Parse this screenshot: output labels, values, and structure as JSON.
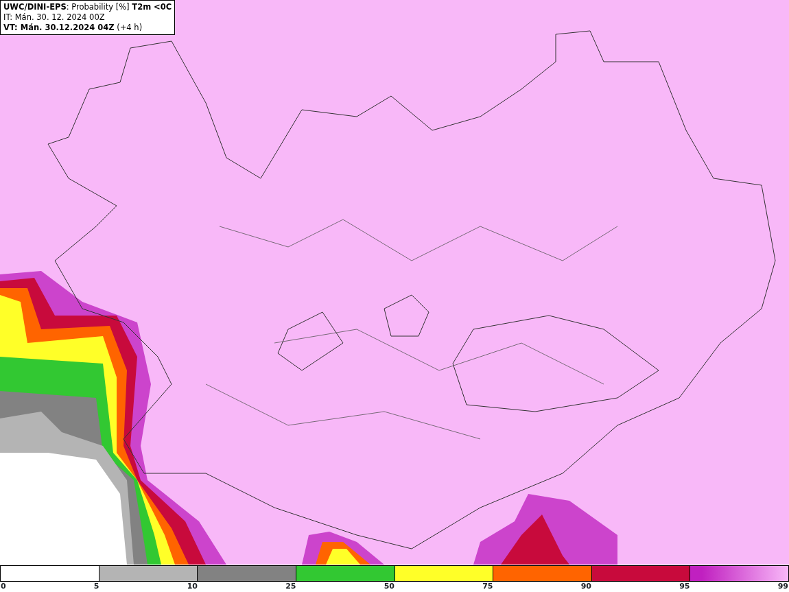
{
  "header": {
    "line_1": "**UWC/DINI-EPS**: Probability [%] **T2m <0C**",
    "line_2": "IT: Mán. 30. 12. 2024 00Z",
    "line_3": "**VT: Mán. 30.12.2024 04Z** (+4 h)"
  },
  "legend": {
    "segments": [
      {
        "color": "#ffffff"
      },
      {
        "color": "#b4b4b4"
      },
      {
        "color": "#828282"
      },
      {
        "color": "#32c832"
      },
      {
        "color": "#ffff28"
      },
      {
        "color": "#ff6400"
      },
      {
        "color": "#c80a3c"
      },
      {
        "color": "#c020c0"
      }
    ],
    "ticks": [
      "0",
      "5",
      "10",
      "25",
      "50",
      "75",
      "90",
      "95",
      "99"
    ]
  }
}
